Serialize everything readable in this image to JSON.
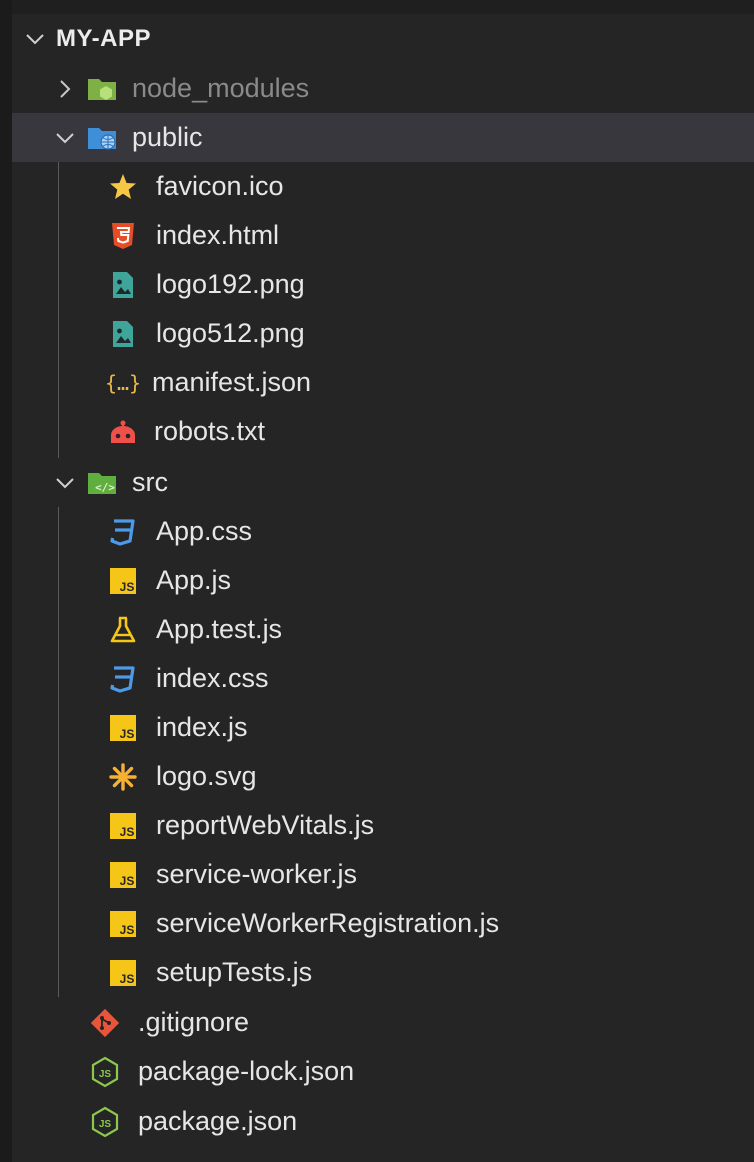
{
  "explorer": {
    "root_label": "MY-APP",
    "items": [
      {
        "label": "node_modules",
        "kind": "folder",
        "expanded": false,
        "icon": "node-modules-folder-icon"
      },
      {
        "label": "public",
        "kind": "folder",
        "expanded": true,
        "icon": "public-folder-icon"
      },
      {
        "label": "favicon.ico",
        "kind": "file",
        "icon": "star-icon"
      },
      {
        "label": "index.html",
        "kind": "file",
        "icon": "html5-icon"
      },
      {
        "label": "logo192.png",
        "kind": "file",
        "icon": "image-file-icon"
      },
      {
        "label": "logo512.png",
        "kind": "file",
        "icon": "image-file-icon"
      },
      {
        "label": "manifest.json",
        "kind": "file",
        "icon": "json-braces-icon"
      },
      {
        "label": "robots.txt",
        "kind": "file",
        "icon": "robot-icon"
      },
      {
        "label": "src",
        "kind": "folder",
        "expanded": true,
        "icon": "src-folder-icon"
      },
      {
        "label": "App.css",
        "kind": "file",
        "icon": "css3-icon"
      },
      {
        "label": "App.js",
        "kind": "file",
        "icon": "js-icon"
      },
      {
        "label": "App.test.js",
        "kind": "file",
        "icon": "test-flask-icon"
      },
      {
        "label": "index.css",
        "kind": "file",
        "icon": "css3-icon"
      },
      {
        "label": "index.js",
        "kind": "file",
        "icon": "js-icon"
      },
      {
        "label": "logo.svg",
        "kind": "file",
        "icon": "svg-asterisk-icon"
      },
      {
        "label": "reportWebVitals.js",
        "kind": "file",
        "icon": "js-icon"
      },
      {
        "label": "service-worker.js",
        "kind": "file",
        "icon": "js-icon"
      },
      {
        "label": "serviceWorkerRegistration.js",
        "kind": "file",
        "icon": "js-icon"
      },
      {
        "label": "setupTests.js",
        "kind": "file",
        "icon": "js-icon"
      },
      {
        "label": ".gitignore",
        "kind": "file",
        "icon": "git-icon"
      },
      {
        "label": "package-lock.json",
        "kind": "file",
        "icon": "nodejs-icon"
      },
      {
        "label": "package.json",
        "kind": "file",
        "icon": "nodejs-icon"
      }
    ]
  },
  "colors": {
    "background": "#252526",
    "selected_row": "#37373d",
    "text": "#e6e6e6",
    "dim_text": "#8a8a8a",
    "js_yellow": "#f5c518",
    "css_blue": "#4d9be8",
    "html_orange": "#e44d26",
    "node_green": "#8cc84b",
    "git_orange": "#e8553a"
  }
}
